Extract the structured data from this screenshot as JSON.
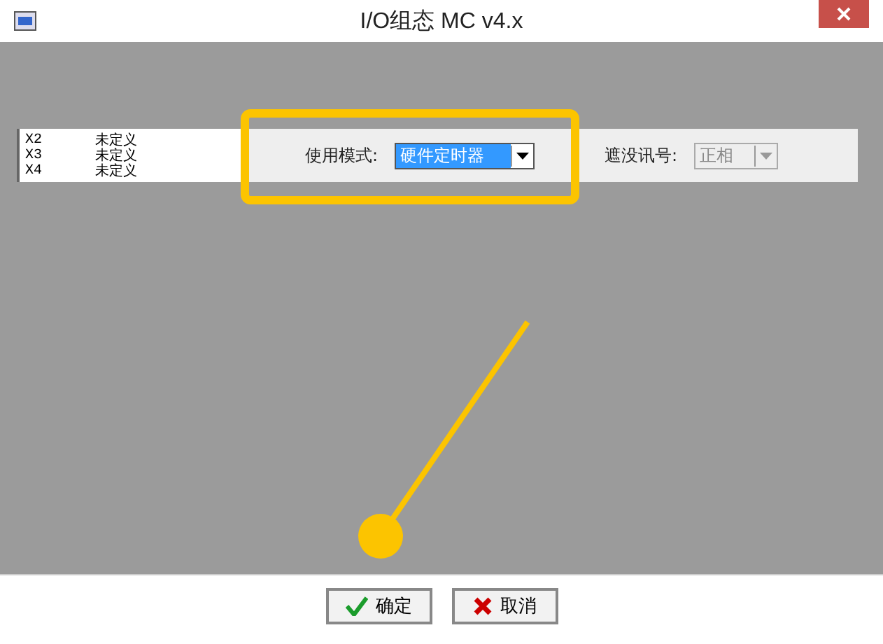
{
  "window": {
    "title": "I/O组态 MC v4.x"
  },
  "list": [
    {
      "port": "X2",
      "status": "未定义"
    },
    {
      "port": "X3",
      "status": "未定义"
    },
    {
      "port": "X4",
      "status": "未定义"
    }
  ],
  "mode": {
    "label": "使用模式:",
    "value": "硬件定时器",
    "selected": true
  },
  "mask": {
    "label": "遮没讯号:",
    "value": "正相",
    "disabled": true
  },
  "buttons": [
    {
      "kind": "ok",
      "label": "确定"
    },
    {
      "kind": "cancel",
      "label": "取消"
    }
  ]
}
